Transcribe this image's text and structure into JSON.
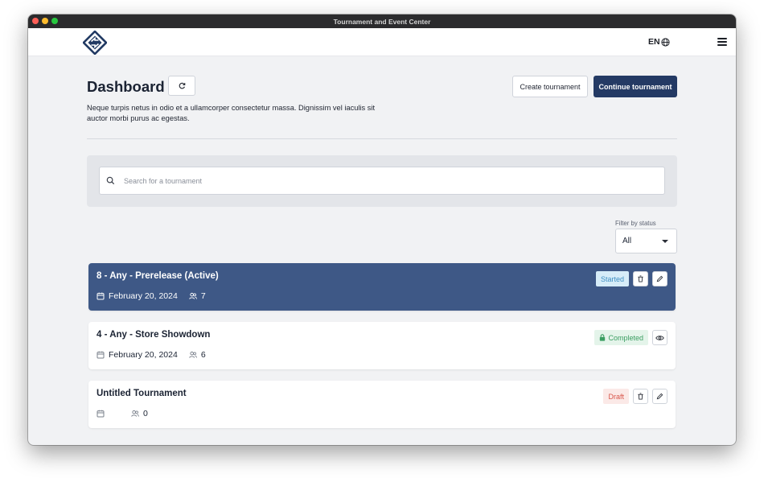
{
  "window": {
    "title": "Tournament and Event Center"
  },
  "nav": {
    "language": "EN"
  },
  "header": {
    "title": "Dashboard",
    "description": "Neque turpis netus in odio et a ullamcorper consectetur massa. Dignissim vel iaculis sit auctor morbi purus ac egestas.",
    "create_label": "Create tournament",
    "continue_label": "Continue tournament"
  },
  "search": {
    "placeholder": "Search for a tournament",
    "value": ""
  },
  "filter": {
    "label": "Filter by status",
    "selected": "All"
  },
  "tournaments": [
    {
      "name": "8 - Any - Prerelease  (Active)",
      "date": "February 20, 2024",
      "players": "7",
      "status": "Started",
      "actions": [
        "delete",
        "edit"
      ],
      "active": true
    },
    {
      "name": "4 - Any - Store Showdown",
      "date": "February 20, 2024",
      "players": "6",
      "status": "Completed",
      "actions": [
        "view"
      ],
      "active": false
    },
    {
      "name": "Untitled Tournament",
      "date": "",
      "players": "0",
      "status": "Draft",
      "actions": [
        "delete",
        "edit"
      ],
      "active": false
    }
  ],
  "colors": {
    "primary": "#243a64",
    "active_card": "#3e5886",
    "started_badge": "#d6ecf8",
    "completed_badge": "#e4f4ea",
    "draft_badge": "#fbe9e7"
  },
  "icons": {
    "refresh": "refresh-icon",
    "language": "globe-icon",
    "menu": "hamburger-menu-icon",
    "search": "search-icon",
    "date": "calendar-icon",
    "players": "users-icon",
    "delete": "trash-icon",
    "edit": "pencil-icon",
    "view": "eye-icon",
    "completed": "lock-icon"
  }
}
